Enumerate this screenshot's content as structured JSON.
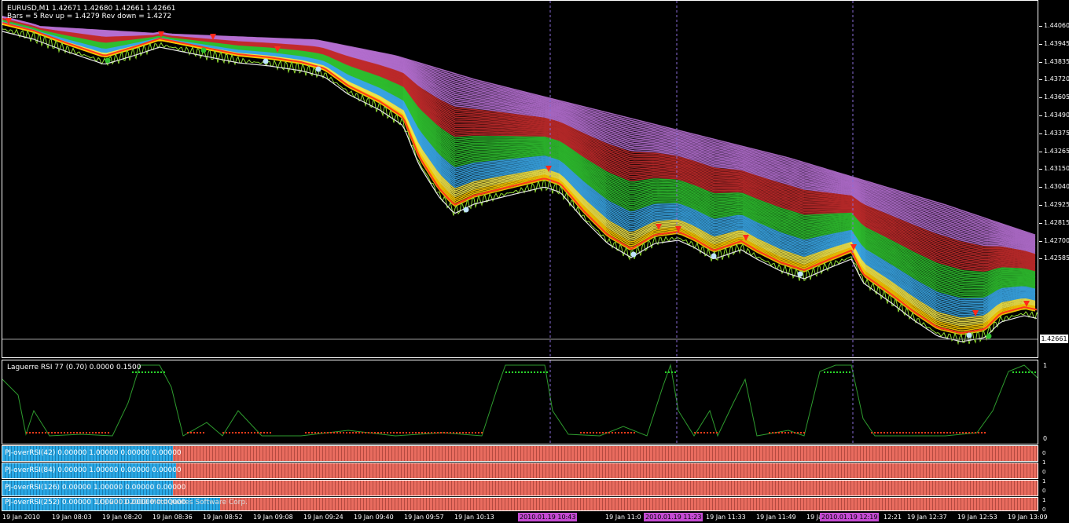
{
  "header": {
    "line1": "EURUSD,M1  1.42671 1.42680 1.42661 1.42661",
    "line2": "Bars = 5 Rev up =  1.4279 Rev down = 1.4272"
  },
  "price_axis": {
    "ticks": [
      "1.44060",
      "1.43945",
      "1.43835",
      "1.43720",
      "1.43605",
      "1.43490",
      "1.43375",
      "1.43265",
      "1.43150",
      "1.43040",
      "1.42925",
      "1.42815",
      "1.42700",
      "1.42585"
    ],
    "current": "1.42661"
  },
  "rsi": {
    "label": "Laguerre RSI 77 (0.70) 0.0000 0.1500",
    "axis_top": "1",
    "axis_bottom": "0"
  },
  "bars": [
    {
      "label": "PJ-overRSI(42) 0.00000 1.00000 0.00000 0.00000",
      "blue_fraction": 0.165
    },
    {
      "label": "PJ-overRSI(84) 0.00000 1.00000 0.00000 0.00000",
      "blue_fraction": 0.168
    },
    {
      "label": "PJ-overRSI(126) 0.00000 1.00000 0.00000 0.00000",
      "blue_fraction": 0.165
    },
    {
      "label": "PJ-overRSI(252) 0.00000 1.00000 0.00000 0.00000",
      "blue_fraction": 0.21
    }
  ],
  "bars_overlay": "(C) 2001-2009 MetaQuotes Software Corp.",
  "bars_axis": [
    "0",
    "1",
    "0",
    "1",
    "0",
    "1",
    "0"
  ],
  "time_axis": {
    "ticks": [
      "19 Jan 2010",
      "19 Jan 08:03",
      "19 Jan 08:20",
      "19 Jan 08:36",
      "19 Jan 08:52",
      "19 Jan 09:08",
      "19 Jan 09:24",
      "19 Jan 09:40",
      "19 Jan 09:57",
      "19 Jan 10:13",
      "10:45",
      "19 Jan 11:0",
      "19 Jan 11:33",
      "19 Jan 11:49",
      "19 Jan 1",
      "12:21",
      "19 Jan 12:37",
      "19 Jan 12:53",
      "19 Jan 13:09"
    ],
    "highlights": [
      "2010.01.19 10:43",
      "2010.01.19 11:23",
      "2010.01.19 12:19"
    ]
  },
  "colors": {
    "background": "#000000",
    "bars_red": "#e96c5f",
    "bars_blue": "#2aa9e6",
    "highlight": "#c54bd3",
    "rsi_line": "#2e9b2e",
    "rsi_dots_low": "#ff3b1a",
    "rsi_dots_high": "#29d629"
  }
}
